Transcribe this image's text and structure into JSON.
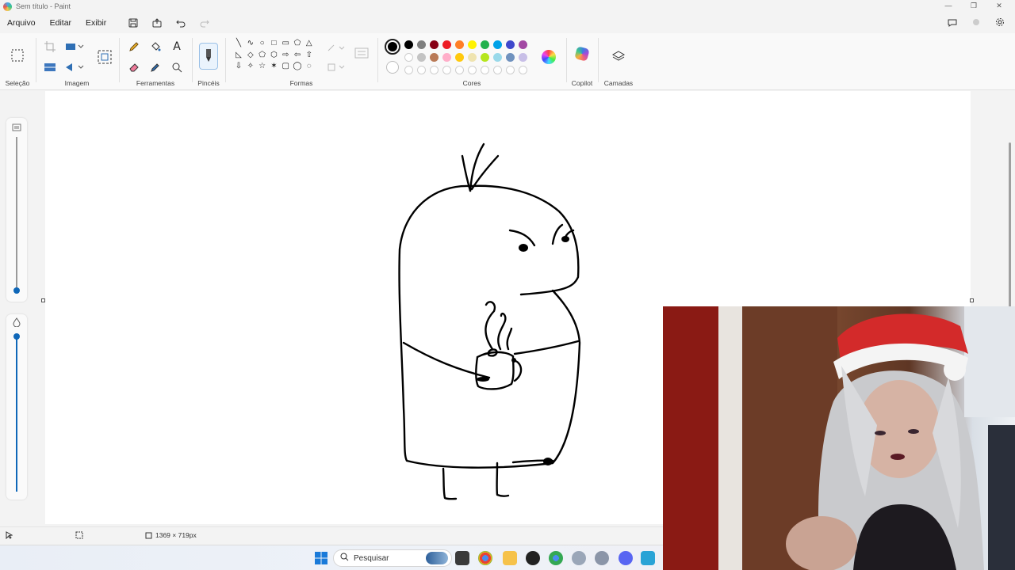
{
  "window": {
    "title": "Sem título - Paint"
  },
  "menu": {
    "file": "Arquivo",
    "edit": "Editar",
    "view": "Exibir"
  },
  "ribbon": {
    "selection_label": "Seleção",
    "image_label": "Imagem",
    "tools_label": "Ferramentas",
    "brushes_label": "Pincéis",
    "shapes_label": "Formas",
    "colors_label": "Cores",
    "copilot_label": "Copilot",
    "layers_label": "Camadas"
  },
  "palette": {
    "primary": "#000000",
    "row1": [
      "#000000",
      "#7f7f7f",
      "#880015",
      "#ed1c24",
      "#ff7f27",
      "#fff200",
      "#22b14c",
      "#00a2e8",
      "#3f48cc",
      "#a349a4"
    ],
    "row2": [
      "#ffffff",
      "#c3c3c3",
      "#b97a57",
      "#ffaec9",
      "#ffc90e",
      "#efe4b0",
      "#b5e61d",
      "#99d9ea",
      "#7092be",
      "#c8bfe7"
    ]
  },
  "status": {
    "canvas_size": "1369 × 719px"
  },
  "taskbar": {
    "search_placeholder": "Pesquisar"
  },
  "icons": {
    "shapes_row1": [
      "╲",
      "∿",
      "○",
      "□",
      "▭",
      "⬠",
      "△"
    ],
    "shapes_row2": [
      "◺",
      "◇",
      "⬠",
      "⬡",
      "⇨",
      "⇦",
      "⇧"
    ],
    "shapes_row3": [
      "⇩",
      "✧",
      "☆",
      "✶",
      "▢",
      "◯",
      "◌"
    ]
  }
}
